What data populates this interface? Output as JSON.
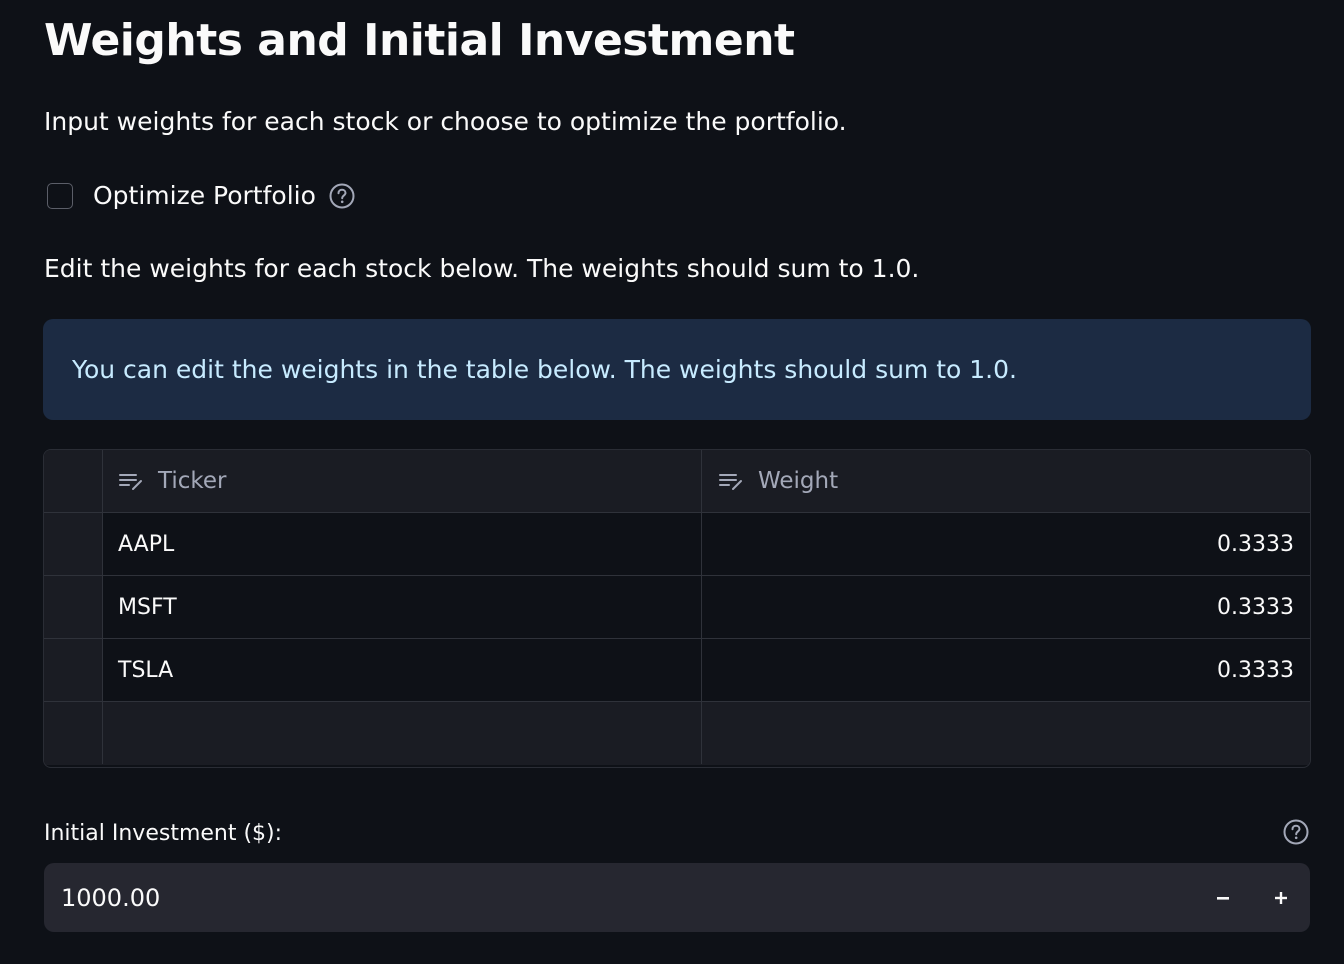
{
  "header": {
    "title": "Weights and Initial Investment",
    "subtitle": "Input weights for each stock or choose to optimize the portfolio."
  },
  "optimize": {
    "label": "Optimize Portfolio",
    "checked": false,
    "help_icon": "question-circle-icon"
  },
  "edit_instructions": "Edit the weights for each stock below. The weights should sum to 1.0.",
  "info_box": {
    "text": "You can edit the weights in the table below. The weights should sum to 1.0."
  },
  "table": {
    "columns": [
      {
        "label": "Ticker",
        "icon": "text-edit-icon"
      },
      {
        "label": "Weight",
        "icon": "text-edit-icon"
      }
    ],
    "rows": [
      {
        "ticker": "AAPL",
        "weight": "0.3333"
      },
      {
        "ticker": "MSFT",
        "weight": "0.3333"
      },
      {
        "ticker": "TSLA",
        "weight": "0.3333"
      }
    ]
  },
  "investment": {
    "label": "Initial Investment ($):",
    "value": "1000.00",
    "minus": "−",
    "plus": "+",
    "help_icon": "question-circle-icon"
  },
  "colors": {
    "background": "#0e1117",
    "info_bg": "#1c2b43",
    "info_text": "#c7ebff",
    "input_bg": "#262730"
  }
}
